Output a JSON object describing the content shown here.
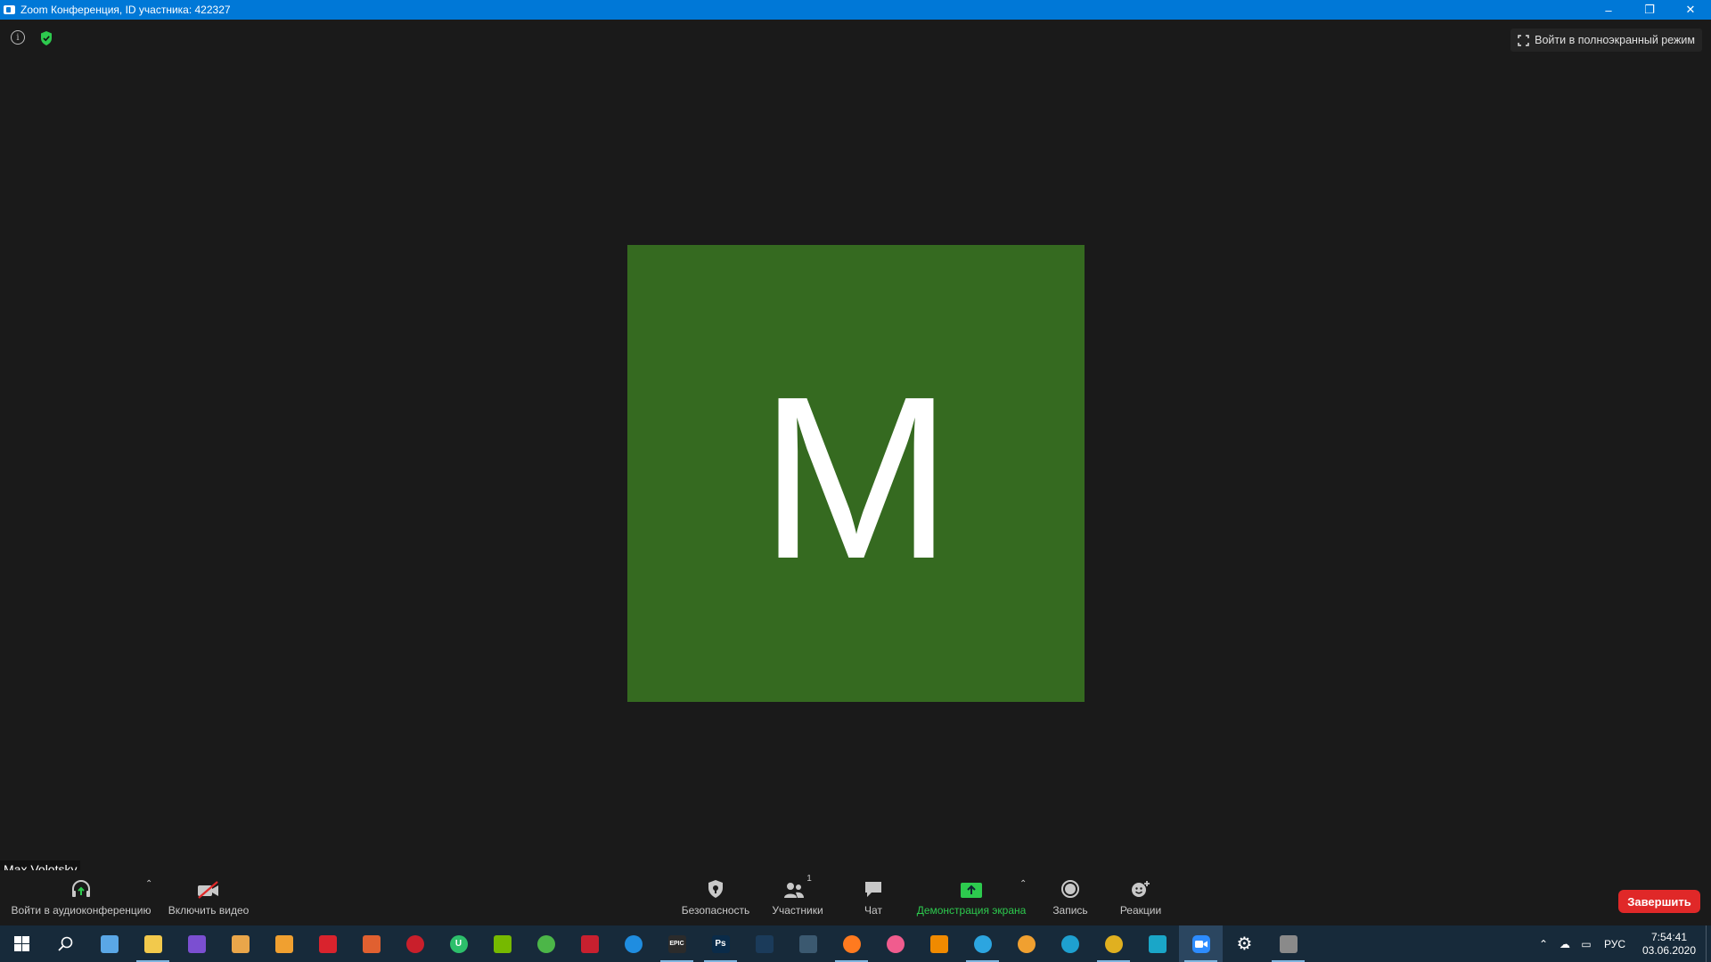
{
  "window": {
    "title": "Zoom Конференция, ID участника: 422327",
    "minimize": "–",
    "restore": "❐",
    "close": "✕"
  },
  "meeting": {
    "fullscreen_label": "Войти в полноэкранный режим",
    "avatar_letter": "M",
    "avatar_color": "#356a20",
    "participant_name": "Max Volotsky"
  },
  "controls": {
    "audio_label": "Войти в аудиоконференцию",
    "video_label": "Включить видео",
    "security_label": "Безопасность",
    "participants_label": "Участники",
    "participants_count": "1",
    "chat_label": "Чат",
    "share_label": "Демонстрация экрана",
    "record_label": "Запись",
    "reactions_label": "Реакции",
    "end_label": "Завершить",
    "share_color": "#2dca4e",
    "end_color": "#e02828"
  },
  "taskbar": {
    "apps": [
      {
        "name": "start-icon",
        "color": "#ffffff",
        "glyph": ""
      },
      {
        "name": "search-icon",
        "color": "#ffffff",
        "glyph": ""
      },
      {
        "name": "task-view-icon",
        "color": "#5aa7e6",
        "glyph": ""
      },
      {
        "name": "file-explorer-icon",
        "color": "#f2c94c",
        "glyph": ""
      },
      {
        "name": "app-purple-icon",
        "color": "#7b4fd1",
        "glyph": ""
      },
      {
        "name": "app-tools-icon",
        "color": "#e9a64a",
        "glyph": ""
      },
      {
        "name": "photos-icon",
        "color": "#f0a030",
        "glyph": ""
      },
      {
        "name": "flash-icon",
        "color": "#d9232d",
        "glyph": ""
      },
      {
        "name": "cross-icon",
        "color": "#e06030",
        "glyph": ""
      },
      {
        "name": "red-circle-icon",
        "color": "#c91f2b",
        "glyph": ""
      },
      {
        "name": "uplay-icon",
        "color": "#2dbf6b",
        "glyph": "U"
      },
      {
        "name": "nvidia-icon",
        "color": "#76b900",
        "glyph": ""
      },
      {
        "name": "utorrent-icon",
        "color": "#4cb648",
        "glyph": ""
      },
      {
        "name": "download-icon",
        "color": "#c8202f",
        "glyph": ""
      },
      {
        "name": "ubisoft-icon",
        "color": "#1f8de0",
        "glyph": ""
      },
      {
        "name": "epic-games-icon",
        "color": "#2b2b2b",
        "glyph": "EPIC"
      },
      {
        "name": "photoshop-icon",
        "color": "#0a2b49",
        "glyph": "Ps"
      },
      {
        "name": "steam-icon",
        "color": "#1b3b5a",
        "glyph": ""
      },
      {
        "name": "box-icon",
        "color": "#3b5970",
        "glyph": ""
      },
      {
        "name": "firefox-icon",
        "color": "#ff7a1f",
        "glyph": ""
      },
      {
        "name": "itunes-icon",
        "color": "#f05c8e",
        "glyph": ""
      },
      {
        "name": "vlc-icon",
        "color": "#f08a00",
        "glyph": ""
      },
      {
        "name": "telegram-icon",
        "color": "#2ca5e0",
        "glyph": ""
      },
      {
        "name": "sun-app-icon",
        "color": "#f0a030",
        "glyph": ""
      },
      {
        "name": "edge-icon",
        "color": "#1ea0d0",
        "glyph": ""
      },
      {
        "name": "chrome-icon",
        "color": "#e0b020",
        "glyph": ""
      },
      {
        "name": "app-s-icon",
        "color": "#1aa6c8",
        "glyph": ""
      },
      {
        "name": "zoom-icon",
        "color": "#2d8cff",
        "glyph": ""
      },
      {
        "name": "settings-icon",
        "color": "#ffffff",
        "glyph": "⚙"
      },
      {
        "name": "snip-icon",
        "color": "#8a8a8a",
        "glyph": ""
      }
    ],
    "language": "РУС",
    "time": "7:54:41",
    "date": "03.06.2020"
  }
}
